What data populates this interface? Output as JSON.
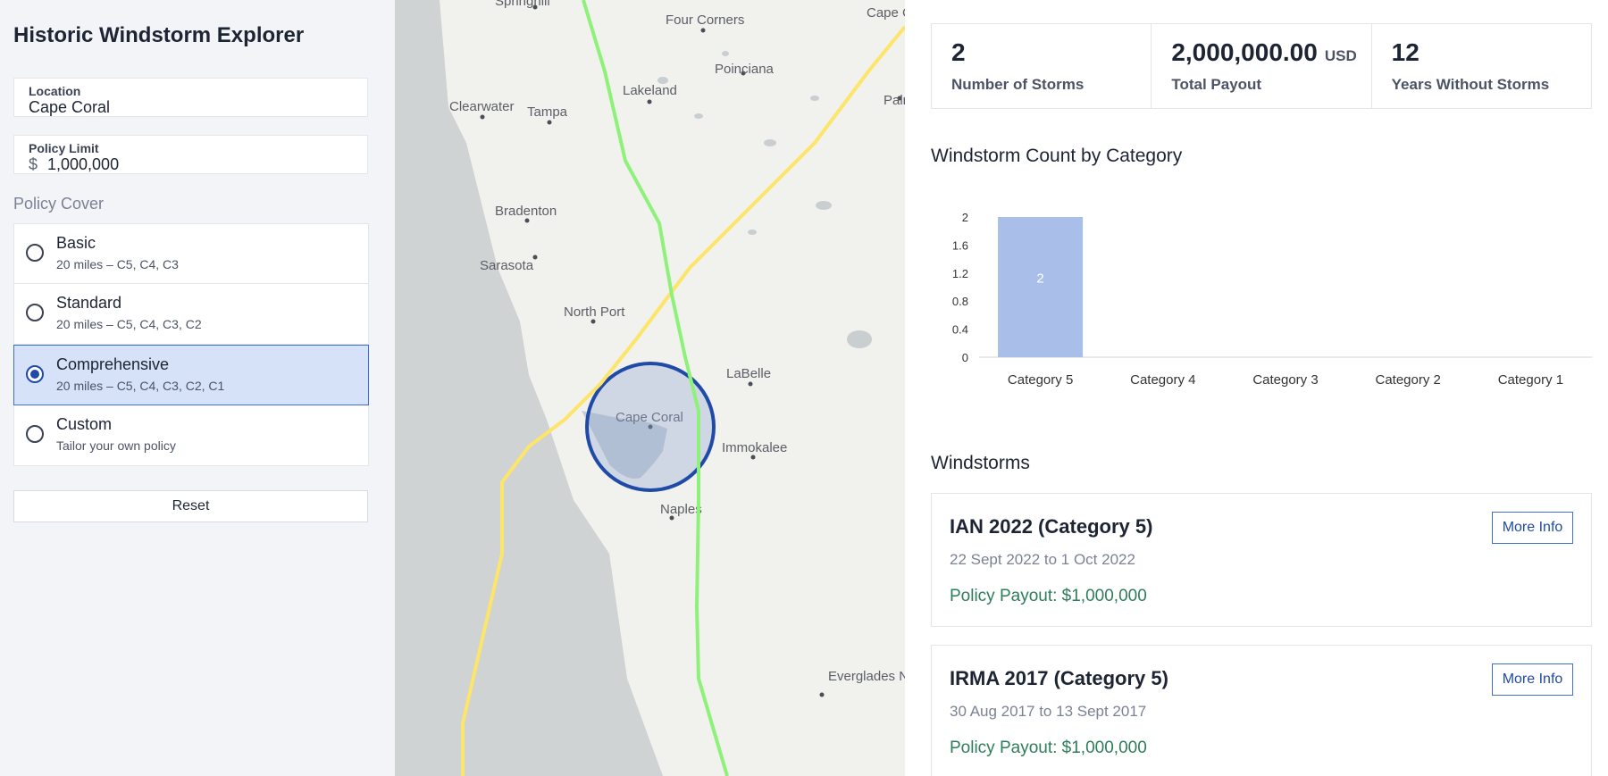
{
  "app": {
    "title": "Historic Windstorm Explorer"
  },
  "location": {
    "label": "Location",
    "value": "Cape Coral"
  },
  "policy_limit": {
    "label": "Policy Limit",
    "currency": "$",
    "value": "1,000,000"
  },
  "policy_cover": {
    "title": "Policy Cover",
    "options": [
      {
        "name": "Basic",
        "desc": "20 miles – C5, C4, C3",
        "selected": false
      },
      {
        "name": "Standard",
        "desc": "20 miles – C5, C4, C3, C2",
        "selected": false
      },
      {
        "name": "Comprehensive",
        "desc": "20 miles – C5, C4, C3, C2, C1",
        "selected": true
      },
      {
        "name": "Custom",
        "desc": "Tailor your own policy",
        "selected": false
      }
    ]
  },
  "reset_label": "Reset",
  "map": {
    "towns": [
      "Springhill",
      "Four Corners",
      "Cape Canaveral",
      "Poinciana",
      "Lakeland",
      "Palm Bay",
      "Clearwater",
      "Tampa",
      "Bradenton",
      "Sarasota",
      "North Port",
      "LaBelle",
      "Cape Coral",
      "Immokalee",
      "Naples",
      "Everglades National Park"
    ],
    "track_colors": {
      "ian": "#fde56a",
      "irma": "#8ef27a"
    },
    "radius_color": "#1f4aa8"
  },
  "stats": [
    {
      "value": "2",
      "unit": "",
      "label": "Number of Storms"
    },
    {
      "value": "2,000,000.00",
      "unit": "USD",
      "label": "Total Payout"
    },
    {
      "value": "12",
      "unit": "",
      "label": "Years Without Storms"
    }
  ],
  "chart_title": "Windstorm Count by Category",
  "chart_data": {
    "type": "bar",
    "categories": [
      "Category 5",
      "Category 4",
      "Category 3",
      "Category 2",
      "Category 1"
    ],
    "values": [
      2,
      0,
      0,
      0,
      0
    ],
    "ylim": [
      0,
      2
    ],
    "yticks": [
      "0",
      "0.4",
      "0.8",
      "1.2",
      "1.6",
      "2"
    ],
    "bar_color": "#a9bfe9",
    "data_labels": [
      "2",
      "",
      "",
      "",
      ""
    ]
  },
  "windstorms_title": "Windstorms",
  "storms": [
    {
      "name": "IAN 2022 (Category 5)",
      "dates": "22 Sept 2022 to 1 Oct 2022",
      "payout": "Policy Payout: $1,000,000",
      "more": "More Info"
    },
    {
      "name": "IRMA 2017 (Category 5)",
      "dates": "30 Aug 2017 to 13 Sept 2017",
      "payout": "Policy Payout: $1,000,000",
      "more": "More Info"
    }
  ]
}
